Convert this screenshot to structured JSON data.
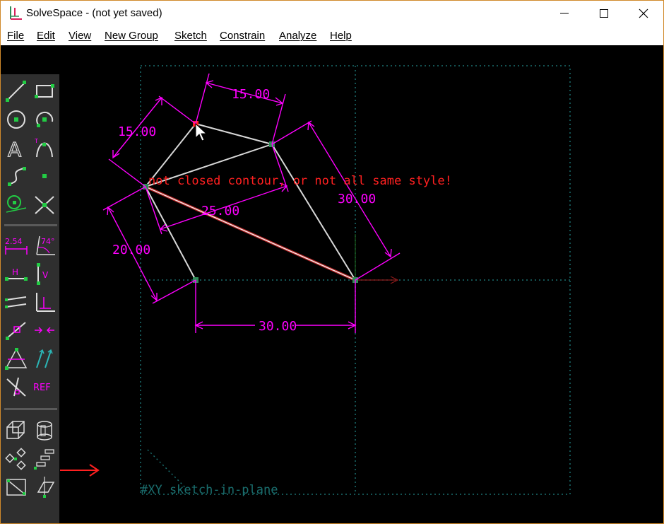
{
  "window": {
    "title": "SolveSpace - (not yet saved)",
    "controls": {
      "minimize": "—",
      "maximize": "☐",
      "close": "✕"
    }
  },
  "menu": [
    {
      "label": "File"
    },
    {
      "label": "Edit"
    },
    {
      "label": "View"
    },
    {
      "label": "New Group"
    },
    {
      "label": "Sketch"
    },
    {
      "label": "Constrain"
    },
    {
      "label": "Analyze"
    },
    {
      "label": "Help"
    }
  ],
  "toolbar": {
    "dimension_icon_text": "2.54",
    "angle_icon_text": "74°",
    "horizontal_icon_text": "H",
    "vertical_icon_text": "V",
    "text_icon_text": "A",
    "ref_icon_text": "REF"
  },
  "sketch": {
    "dimensions": {
      "top_edge": "15.00",
      "left_edge": "15.00",
      "right_edge": "30.00",
      "diagonal": "25.00",
      "lower_left": "20.00",
      "bottom": "30.00"
    },
    "error_message": "not closed contour, or not all same style!",
    "workplane_label": "#XY  sketch-in-plane"
  },
  "colors": {
    "canvas": "#000000",
    "toolbar": "#2f2f2f",
    "constraint": "#ff00ff",
    "line": "#d8d8d8",
    "error": "#ff2020",
    "point": "#2e8b57",
    "workplane": "#1a6f6f"
  }
}
